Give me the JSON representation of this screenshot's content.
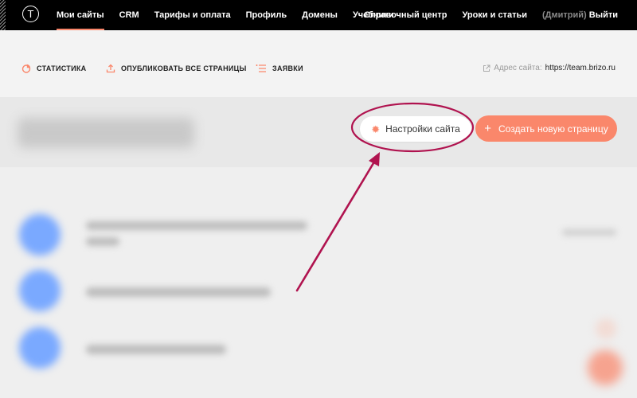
{
  "nav": {
    "logo_letter": "T",
    "items": [
      {
        "label": "Мои сайты",
        "active": true
      },
      {
        "label": "CRM"
      },
      {
        "label": "Тарифы и оплата"
      },
      {
        "label": "Профиль"
      },
      {
        "label": "Домены"
      },
      {
        "label": "Учебники"
      }
    ],
    "right": {
      "help": "Справочный центр",
      "lessons": "Уроки и статьи",
      "user": "(Дмитрий)",
      "logout": "Выйти"
    }
  },
  "toolbar": {
    "stats": "СТАТИСТИКА",
    "publish_all": "ОПУБЛИКОВАТЬ ВСЕ СТРАНИЦЫ",
    "leads": "ЗАЯВКИ",
    "address_label": "Адрес сайта:",
    "address_value": "https://team.brizo.ru"
  },
  "header": {
    "settings_label": "Настройки сайта",
    "create_label": "Создать новую страницу"
  },
  "colors": {
    "accent": "#fa876b",
    "annotation": "#b0134f",
    "topbar": "#000000"
  },
  "icons": {
    "stats": "pie-chart-icon",
    "publish": "upload-icon",
    "leads": "list-icon",
    "external": "external-link-icon",
    "settings": "gear-icon",
    "create": "plus-icon"
  }
}
